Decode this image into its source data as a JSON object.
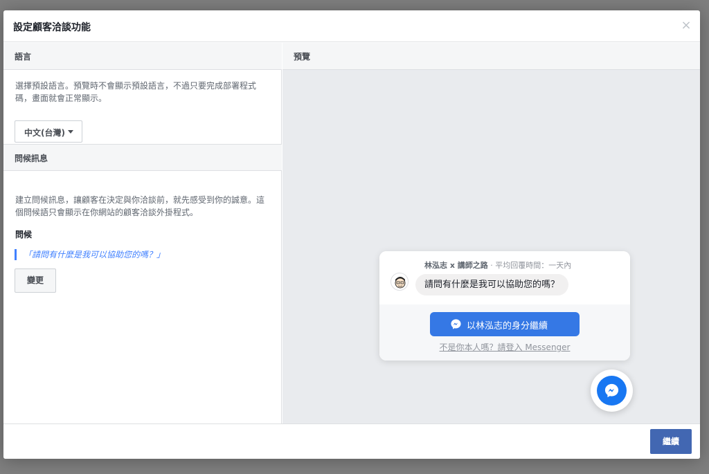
{
  "dialog": {
    "title": "設定顧客洽談功能",
    "close_icon": "×"
  },
  "language": {
    "section_title": "語言",
    "description": "選擇預設語言。預覽時不會顯示預設語言，不過只要完成部署程式碼，畫面就會正常顯示。",
    "selected": "中文(台灣)"
  },
  "greeting": {
    "section_title": "問候訊息",
    "description": "建立問候訊息，讓顧客在決定與你洽談前，就先感受到你的誠意。這個問候語只會顯示在你網站的顧客洽談外掛程式。",
    "label": "問候",
    "text": "「請問有什麼是我可以協助您的嗎？」",
    "change_button": "變更"
  },
  "preview": {
    "section_title": "預覽",
    "page_name": "林泓志 x 講師之路",
    "response_time": "· 平均回覆時間：一天內",
    "bubble_text": "請問有什麼是我可以協助您的嗎？",
    "continue_as": "以林泓志的身分繼續",
    "not_you": "不是你本人嗎？請登入 Messenger"
  },
  "footer": {
    "continue_button": "繼續"
  },
  "colors": {
    "messenger_blue": "#3578e5",
    "fab_blue": "#1877f2",
    "primary_button": "#4267b2",
    "greeting_accent": "#4080ff"
  },
  "icons": {
    "close": "close-icon",
    "caret": "caret-down-icon",
    "messenger": "messenger-icon",
    "avatar": "avatar-illustration"
  }
}
